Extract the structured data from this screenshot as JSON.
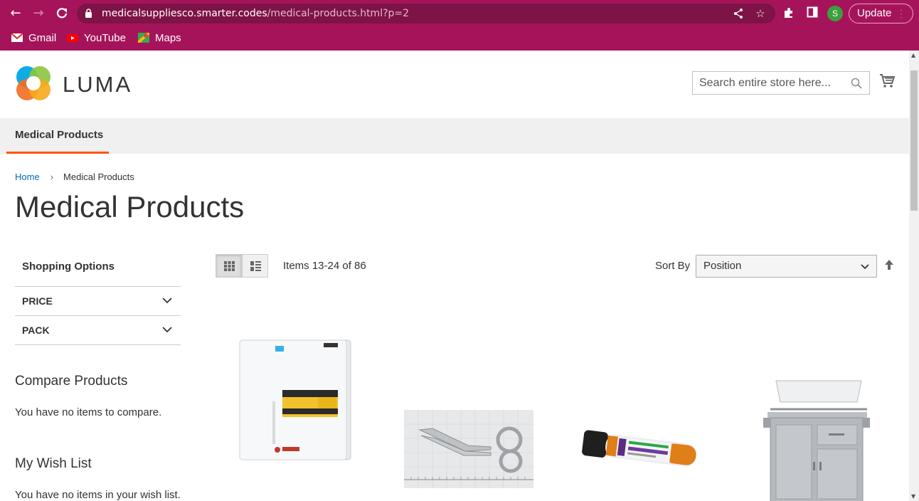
{
  "browser": {
    "url_host": "medicalsuppliesco.smarter.codes",
    "url_path": "/medical-products.html?p=2",
    "profile_initial": "S",
    "update_label": "Update",
    "bookmarks": [
      {
        "label": "Gmail",
        "icon": "gmail-icon"
      },
      {
        "label": "YouTube",
        "icon": "youtube-icon"
      },
      {
        "label": "Maps",
        "icon": "maps-icon"
      }
    ]
  },
  "header": {
    "logo_text": "LUMA",
    "search_placeholder": "Search entire store here..."
  },
  "nav": {
    "items": [
      {
        "label": "Medical Products"
      }
    ]
  },
  "breadcrumb": {
    "home": "Home",
    "current": "Medical Products"
  },
  "page_title": "Medical Products",
  "sidebar": {
    "shopping_options": "Shopping Options",
    "filters": [
      {
        "label": "PRICE"
      },
      {
        "label": "PACK"
      }
    ],
    "compare_title": "Compare Products",
    "compare_text": "You have no items to compare.",
    "wishlist_title": "My Wish List",
    "wishlist_text": "You have no items in your wish list."
  },
  "toolbar": {
    "amount": "Items 13-24 of 86",
    "sort_label": "Sort By",
    "sort_value": "Position"
  },
  "products": [
    {
      "name": "refrigerator",
      "icon": "refrigerator-image"
    },
    {
      "name": "bandage-scissors",
      "icon": "scissors-image"
    },
    {
      "name": "blood-collection-tube",
      "icon": "tube-image"
    },
    {
      "name": "stainless-steel-cart",
      "icon": "cart-image"
    }
  ],
  "colors": {
    "chrome": "#a5145a",
    "accent": "#ff5501",
    "link": "#006bb4"
  }
}
